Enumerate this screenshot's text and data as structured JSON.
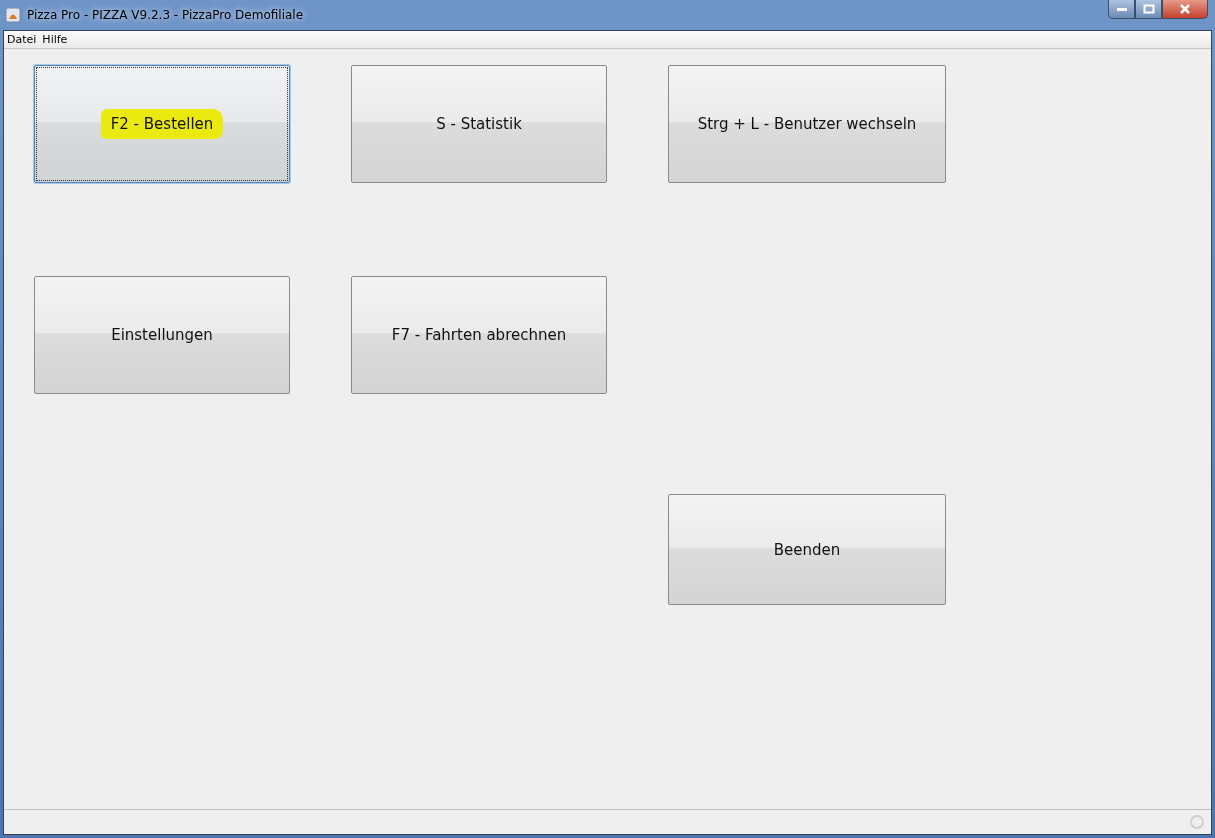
{
  "window": {
    "title": "Pizza Pro - PIZZA V9.2.3 - PizzaPro Demofiliale"
  },
  "menu": [
    {
      "label": "Datei"
    },
    {
      "label": "Hilfe"
    }
  ],
  "buttons": [
    {
      "label": "F2 - Bestellen",
      "focused": true,
      "highlighted": true
    },
    {
      "label": "S - Statistik",
      "focused": false,
      "highlighted": false
    },
    {
      "label": "Strg + L - Benutzer wechseln",
      "focused": false,
      "highlighted": false
    },
    {
      "label": "Einstellungen",
      "focused": false,
      "highlighted": false
    },
    {
      "label": "F7 - Fahrten abrechnen",
      "focused": false,
      "highlighted": false
    },
    {
      "label": "Beenden",
      "focused": false,
      "highlighted": false
    }
  ]
}
